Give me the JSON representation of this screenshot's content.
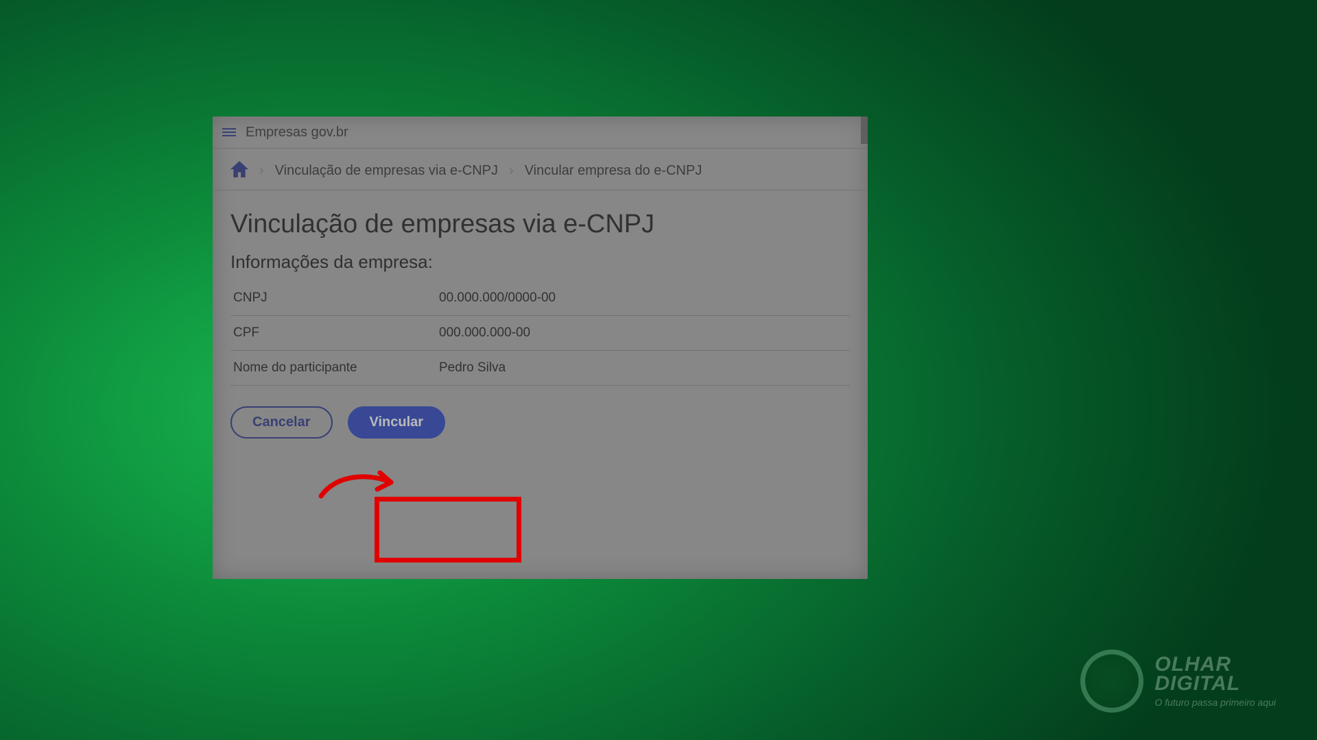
{
  "appbar": {
    "title": "Empresas gov.br"
  },
  "breadcrumb": {
    "items": [
      "Vinculação de empresas via e-CNPJ",
      "Vincular empresa do e-CNPJ"
    ]
  },
  "page": {
    "title": "Vinculação de empresas via e-CNPJ",
    "section_title": "Informações da empresa:"
  },
  "info": {
    "rows": [
      {
        "label": "CNPJ",
        "value": "00.000.000/0000-00"
      },
      {
        "label": "CPF",
        "value": "000.000.000-00"
      },
      {
        "label": "Nome do participante",
        "value": "Pedro Silva"
      }
    ]
  },
  "actions": {
    "cancel": "Cancelar",
    "primary": "Vincular"
  },
  "brand": {
    "line1": "OLHAR",
    "line2": "DIGITAL",
    "tagline": "O futuro passa primeiro aqui"
  },
  "annotation": {
    "highlight_target": "vincular-button",
    "arrow_color": "#e00000"
  }
}
